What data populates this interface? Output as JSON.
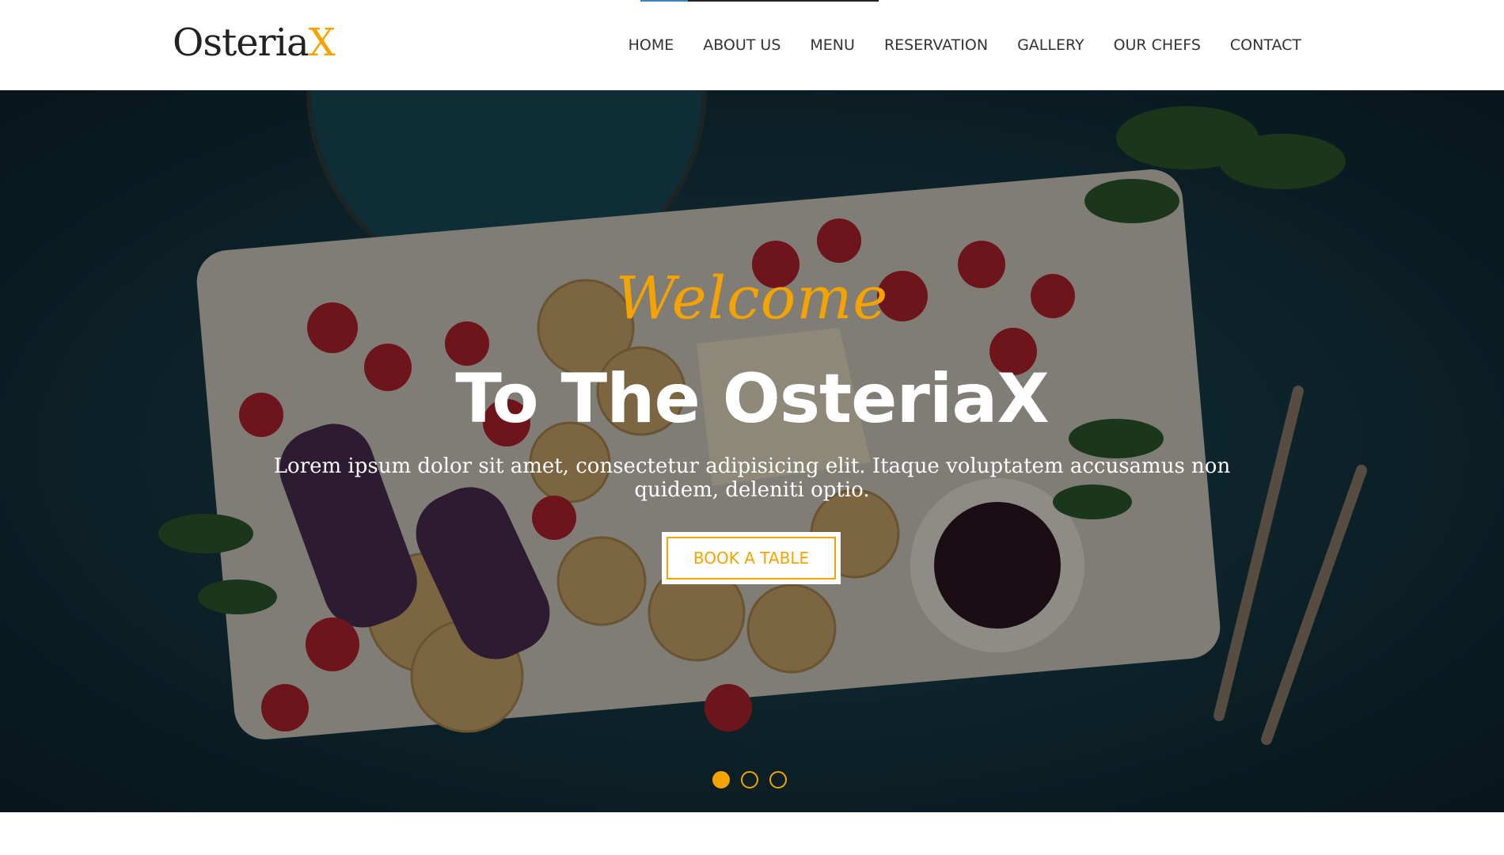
{
  "brand": {
    "name_main": "Osteria",
    "name_accent": "X",
    "accent_color": "#f5a300"
  },
  "nav": {
    "items": [
      {
        "label": "HOME"
      },
      {
        "label": "ABOUT US"
      },
      {
        "label": "MENU"
      },
      {
        "label": "RESERVATION"
      },
      {
        "label": "GALLERY"
      },
      {
        "label": "OUR CHEFS"
      },
      {
        "label": "CONTACT"
      }
    ]
  },
  "hero": {
    "welcome": "Welcome",
    "headline": "To The OsteriaX",
    "subtext": "Lorem ipsum dolor sit amet, consectetur adipisicing elit. Itaque voluptatem accusamus non quidem, deleniti optio.",
    "cta_label": "BOOK A TABLE",
    "slides": {
      "count": 3,
      "active": 1
    }
  }
}
